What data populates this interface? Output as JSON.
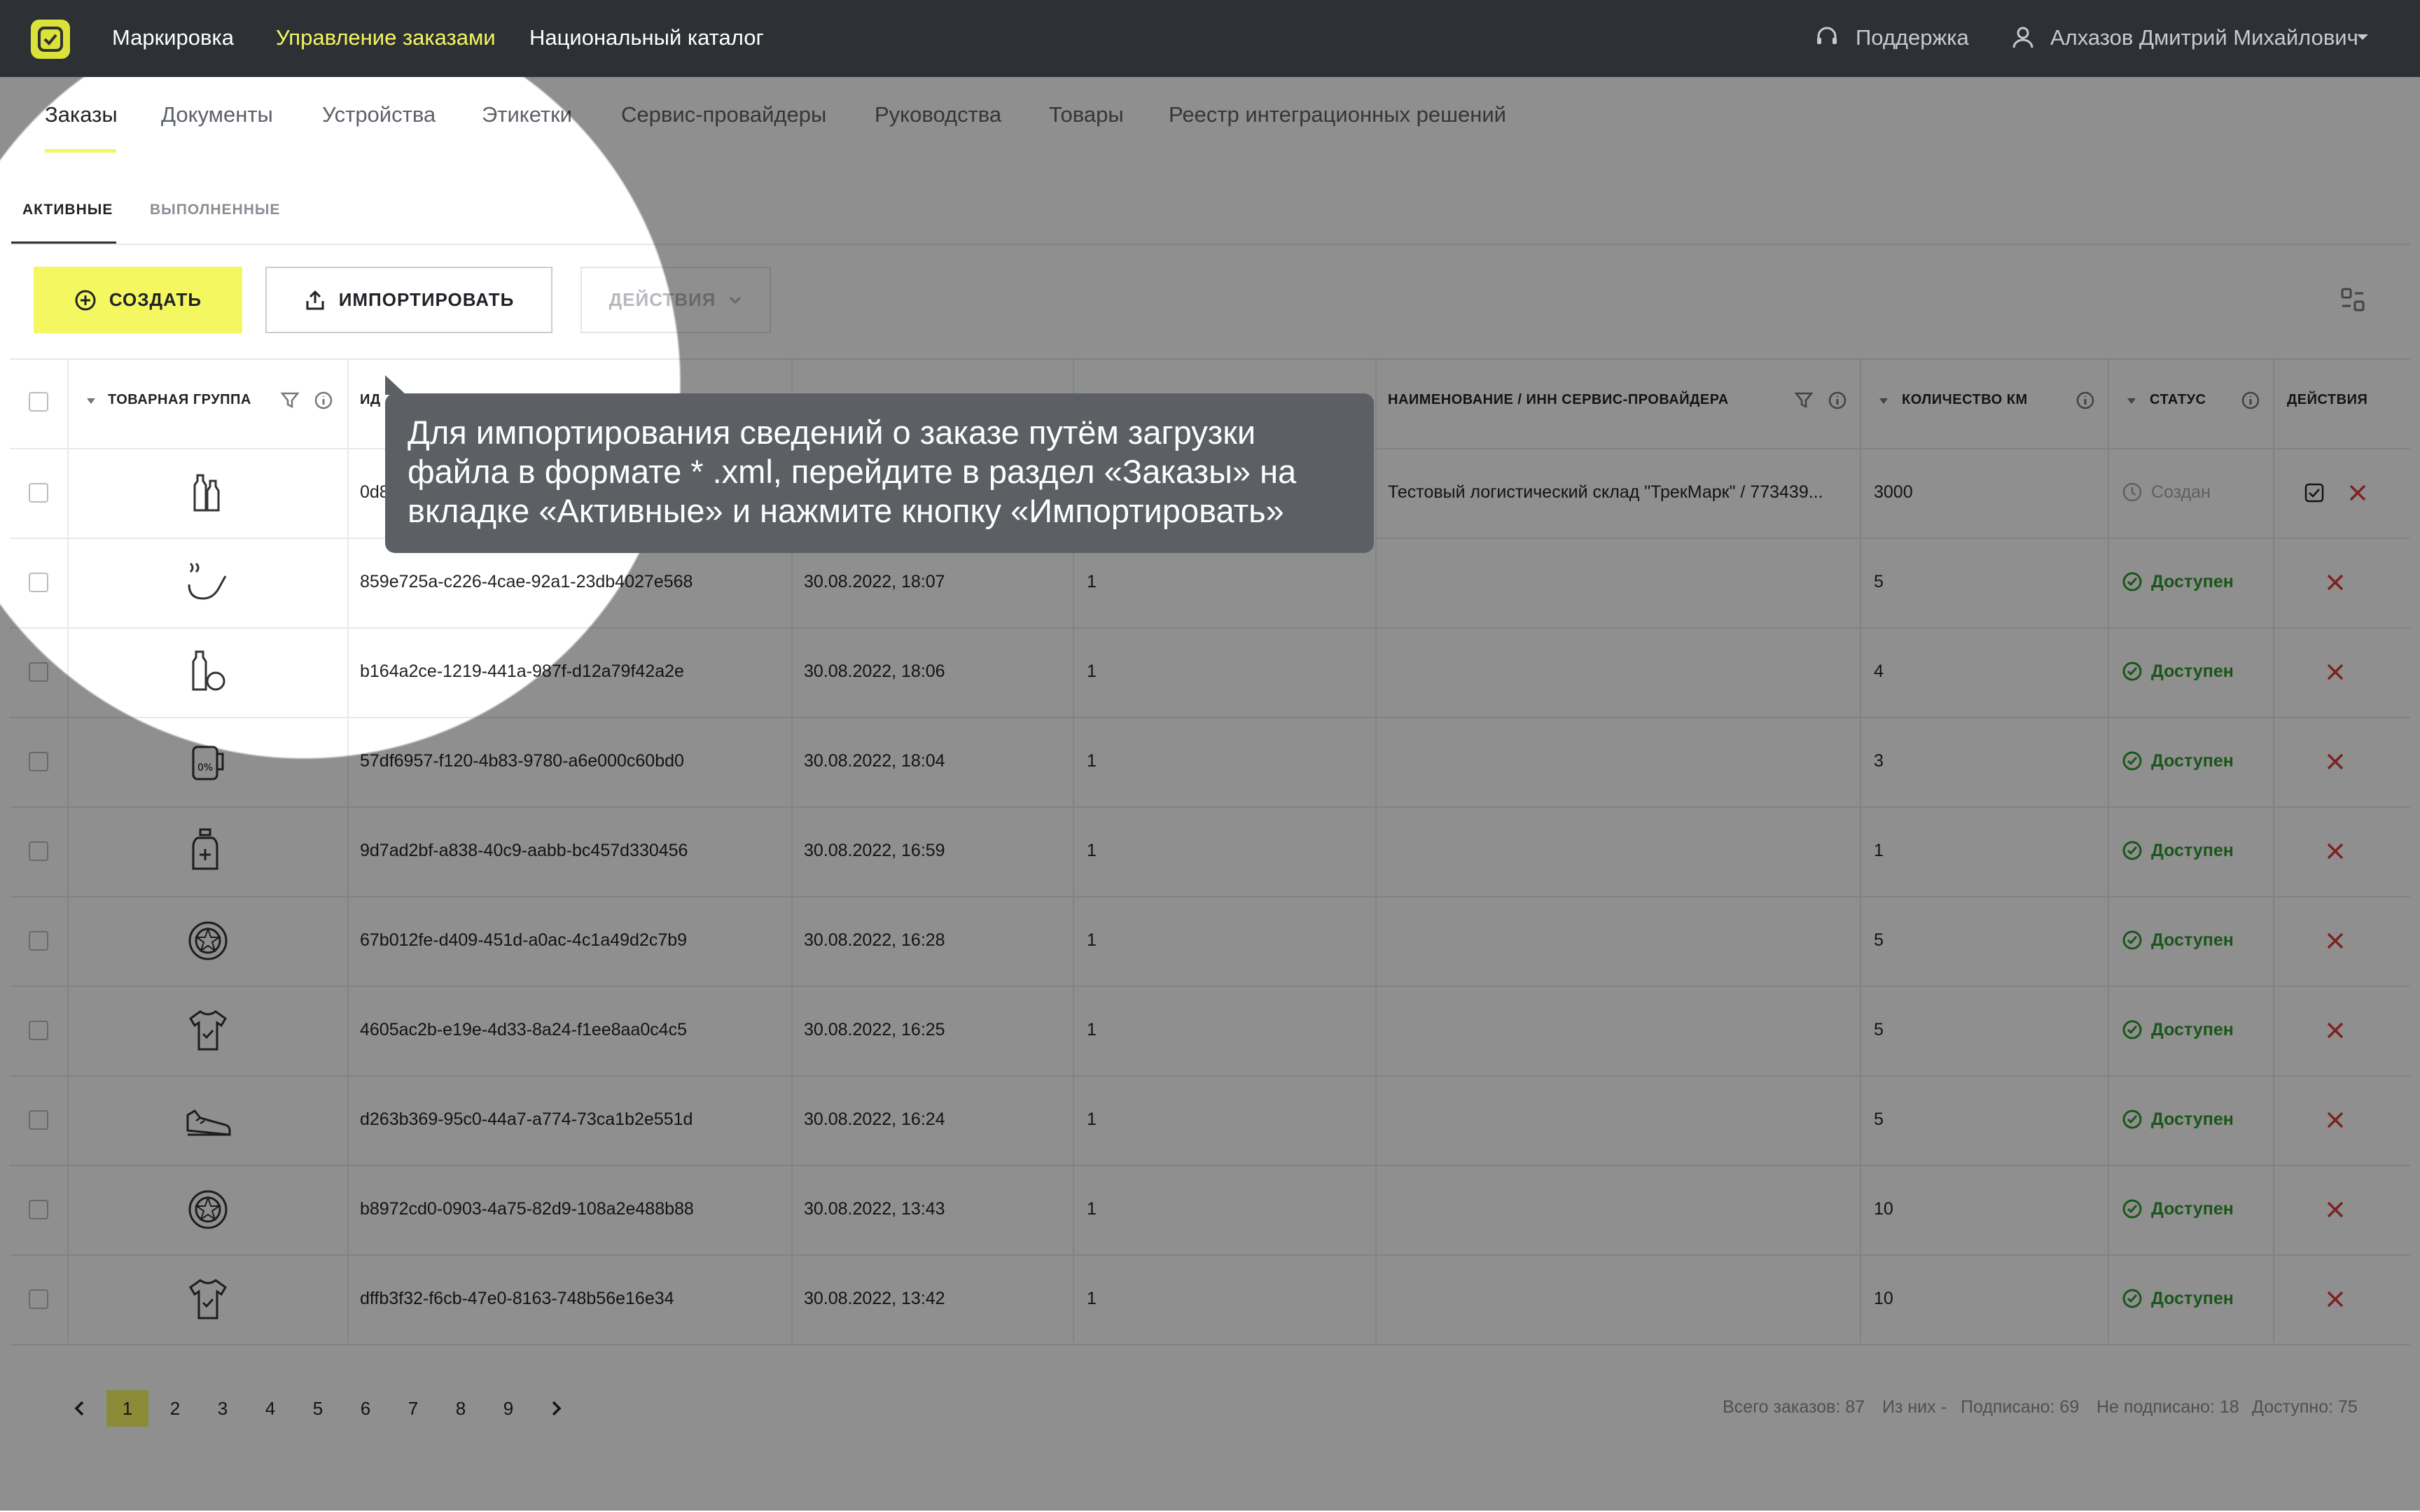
{
  "topbar": {
    "nav": [
      "Маркировка",
      "Управление заказами",
      "Национальный каталог"
    ],
    "support": "Поддержка",
    "user": "Алхазов Дмитрий Михайлович"
  },
  "tabs": [
    "Заказы",
    "Документы",
    "Устройства",
    "Этикетки",
    "Сервис-провайдеры",
    "Руководства",
    "Товары",
    "Реестр интеграционных решений"
  ],
  "subtabs": [
    "АКТИВНЫЕ",
    "ВЫПОЛНЕННЫЕ"
  ],
  "toolbar": {
    "create": "СОЗДАТЬ",
    "import": "ИМПОРТИРОВАТЬ",
    "actions": "ДЕЙСТВИЯ"
  },
  "table": {
    "headers": {
      "group": "ТОВАРНАЯ ГРУППА",
      "id": "ИД",
      "provider": "НАИМЕНОВАНИЕ / ИНН СЕРВИС-ПРОВАЙДЕРА",
      "km": "КОЛИЧЕСТВО КМ",
      "status": "СТАТУС",
      "actions": "ДЕЙСТВИЯ"
    },
    "rows": [
      {
        "icon": "bottles-icon",
        "id": "0d8",
        "date": "",
        "count": "",
        "provider": "Тестовый логистический склад \"ТрекМарк\" / 773439...",
        "km": "3000",
        "status": "Создан"
      },
      {
        "icon": "pipe-icon",
        "id": "859e725a-c226-4cae-92a1-23db4027e568",
        "date": "30.08.2022, 18:07",
        "count": "1",
        "provider": "",
        "km": "5",
        "status": "Доступен"
      },
      {
        "icon": "bottle-apple-icon",
        "id": "b164a2ce-1219-441a-987f-d12a79f42a2e",
        "date": "30.08.2022, 18:06",
        "count": "1",
        "provider": "",
        "km": "4",
        "status": "Доступен"
      },
      {
        "icon": "milk-can-icon",
        "id": "57df6957-f120-4b83-9780-a6e000c60bd0",
        "date": "30.08.2022, 18:04",
        "count": "1",
        "provider": "",
        "km": "3",
        "status": "Доступен"
      },
      {
        "icon": "medicine-bottle-icon",
        "id": "9d7ad2bf-a838-40c9-aabb-bc457d330456",
        "date": "30.08.2022, 16:59",
        "count": "1",
        "provider": "",
        "km": "1",
        "status": "Доступен"
      },
      {
        "icon": "tire-icon",
        "id": "67b012fe-d409-451d-a0ac-4c1a49d2c7b9",
        "date": "30.08.2022, 16:28",
        "count": "1",
        "provider": "",
        "km": "5",
        "status": "Доступен"
      },
      {
        "icon": "shirt-icon",
        "id": "4605ac2b-e19e-4d33-8a24-f1ee8aa0c4c5",
        "date": "30.08.2022, 16:25",
        "count": "1",
        "provider": "",
        "km": "5",
        "status": "Доступен"
      },
      {
        "icon": "shoe-icon",
        "id": "d263b369-95c0-44a7-a774-73ca1b2e551d",
        "date": "30.08.2022, 16:24",
        "count": "1",
        "provider": "",
        "km": "5",
        "status": "Доступен"
      },
      {
        "icon": "tire-icon",
        "id": "b8972cd0-0903-4a75-82d9-108a2e488b88",
        "date": "30.08.2022, 13:43",
        "count": "1",
        "provider": "",
        "km": "10",
        "status": "Доступен"
      },
      {
        "icon": "shirt-icon",
        "id": "dffb3f32-f6cb-47e0-8163-748b56e16e34",
        "date": "30.08.2022, 13:42",
        "count": "1",
        "provider": "",
        "km": "10",
        "status": "Доступен"
      }
    ]
  },
  "pagination": {
    "pages": [
      "1",
      "2",
      "3",
      "4",
      "5",
      "6",
      "7",
      "8",
      "9"
    ],
    "current": "1",
    "summary": [
      "Всего заказов: 87",
      "Из них -",
      "Подписано: 69",
      "Не подписано: 18",
      "Доступно: 75"
    ]
  },
  "tooltip": {
    "lines": [
      "Для импортирования сведений о заказе путём загрузки",
      "файла в формате * .xml, перейдите в раздел «Заказы» на",
      "вкладке «Активные» и нажмите кнопку «Импортировать»"
    ]
  },
  "colors": {
    "accent": "#f4f760",
    "topbar": "#2d3035",
    "ok": "#2e9a2e",
    "danger": "#e03a3a"
  }
}
